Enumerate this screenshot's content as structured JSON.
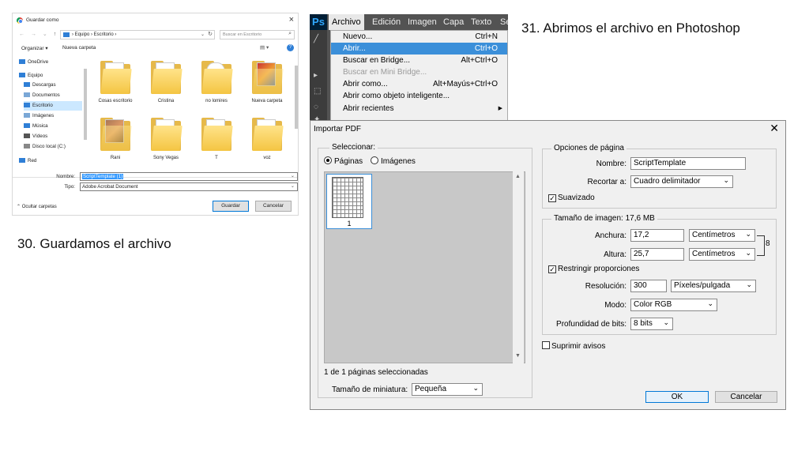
{
  "save_dialog": {
    "title": "Guardar como",
    "close": "×",
    "nav_back": "←",
    "nav_fwd": "→",
    "nav_recent": "⌄",
    "nav_up": "↑",
    "address_path": "›  Equipo  ›  Escritorio  ›",
    "address_dropdown": "⌄",
    "refresh": "↻",
    "search_placeholder": "Buscar en Escritorio",
    "search_icon": "⌕",
    "organize": "Organizar ▾",
    "new_folder": "Nueva carpeta",
    "view_options": "▤ ▾",
    "help": "?",
    "tree": [
      {
        "label": "OneDrive",
        "color": "#2f7fd6"
      },
      {
        "label": "Equipo",
        "color": "#2f7fd6"
      },
      {
        "label": "Descargas",
        "color": "#2f7fd6"
      },
      {
        "label": "Documentos",
        "color": "#7aa7d6"
      },
      {
        "label": "Escritorio",
        "color": "#2f7fd6"
      },
      {
        "label": "Imágenes",
        "color": "#7aa7d6"
      },
      {
        "label": "Música",
        "color": "#2f7fd6"
      },
      {
        "label": "Vídeos",
        "color": "#555555"
      },
      {
        "label": "Disco local (C:)",
        "color": "#888888"
      },
      {
        "label": "Red",
        "color": "#2f7fd6"
      }
    ],
    "files": [
      {
        "label": "Cosas escritorio"
      },
      {
        "label": "Cristina"
      },
      {
        "label": "no lomires"
      },
      {
        "label": "Nueva carpeta"
      },
      {
        "label": "Rani"
      },
      {
        "label": "Sony Vegas"
      },
      {
        "label": "T"
      },
      {
        "label": "voz"
      }
    ],
    "name_label": "Nombre:",
    "name_value": "ScriptTemplate (1)",
    "type_label": "Tipo:",
    "type_value": "Adobe Acrobat Document",
    "dropdown": "⌄",
    "hide_folders": "⌃  Ocultar carpetas",
    "save_button": "Guardar",
    "cancel_button": "Cancelar"
  },
  "captions": {
    "step30": "30. Guardamos el archivo",
    "step31": "31. Abrimos el archivo en Photoshop"
  },
  "photoshop": {
    "logo": "Ps",
    "menubar": [
      "Archivo",
      "Edición",
      "Imagen",
      "Capa",
      "Texto",
      "Se"
    ],
    "menu_items": [
      {
        "label": "Nuevo...",
        "shortcut": "Ctrl+N"
      },
      {
        "label": "Abrir...",
        "shortcut": "Ctrl+O"
      },
      {
        "label": "Buscar en Bridge...",
        "shortcut": "Alt+Ctrl+O"
      },
      {
        "label": "Buscar en Mini Bridge...",
        "shortcut": ""
      },
      {
        "label": "Abrir como...",
        "shortcut": "Alt+Mayús+Ctrl+O"
      },
      {
        "label": "Abrir como objeto inteligente...",
        "shortcut": ""
      },
      {
        "label": "Abrir recientes",
        "shortcut": ""
      }
    ],
    "submenu_arrow": "▶"
  },
  "import_pdf": {
    "title": "Importar PDF",
    "close": "✕",
    "select_label": "Seleccionar:",
    "radio_pages": "Páginas",
    "radio_images": "Imágenes",
    "thumb_number": "1",
    "scroll_up": "▲",
    "scroll_down": "▼",
    "selection_status": "1 de 1 páginas seleccionadas",
    "thumb_size_label": "Tamaño de miniatura:",
    "thumb_size_value": "Pequeña",
    "page_options_label": "Opciones de página",
    "name_label": "Nombre:",
    "name_value": "ScriptTemplate",
    "crop_label": "Recortar a:",
    "crop_value": "Cuadro delimitador",
    "smooth_label": "Suavizado",
    "image_size_label": "Tamaño de imagen: 17,6 MB",
    "width_label": "Anchura:",
    "width_value": "17,2",
    "width_unit": "Centímetros",
    "height_label": "Altura:",
    "height_value": "25,7",
    "height_unit": "Centímetros",
    "link_icon": "8",
    "constrain_label": "Restringir proporciones",
    "resolution_label": "Resolución:",
    "resolution_value": "300",
    "resolution_unit": "Píxeles/pulgada",
    "mode_label": "Modo:",
    "mode_value": "Color RGB",
    "bit_depth_label": "Profundidad de bits:",
    "bit_depth_value": "8 bits",
    "suppress_label": "Suprimir avisos",
    "check": "✓",
    "dropdown": "⌄",
    "ok_button": "OK",
    "cancel_button": "Cancelar"
  }
}
